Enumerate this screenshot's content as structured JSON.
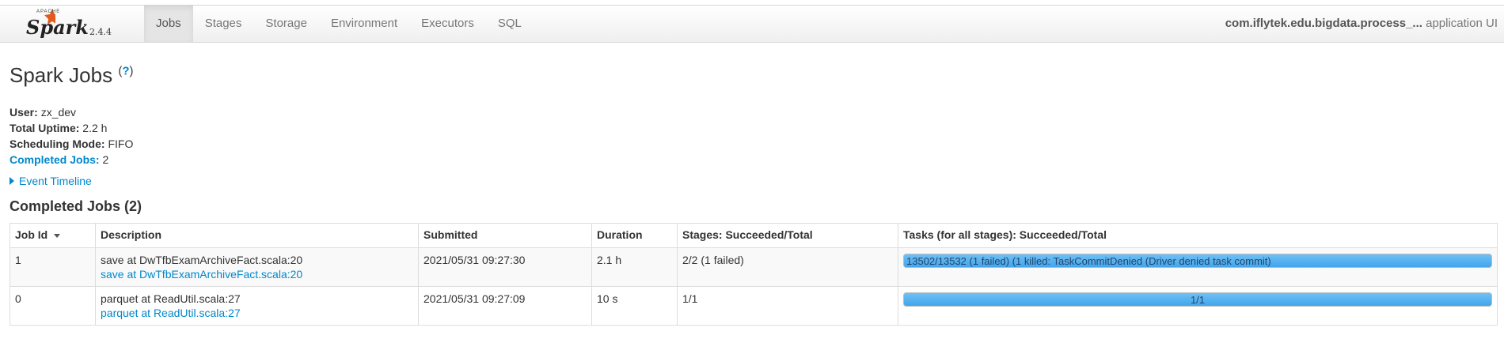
{
  "brand": {
    "apache": "APACHE",
    "spark": "Spark",
    "version": "2.4.4"
  },
  "nav": {
    "tabs": [
      {
        "label": "Jobs",
        "active": true
      },
      {
        "label": "Stages"
      },
      {
        "label": "Storage"
      },
      {
        "label": "Environment"
      },
      {
        "label": "Executors"
      },
      {
        "label": "SQL"
      }
    ],
    "app_name": "com.iflytek.edu.bigdata.process_...",
    "app_suffix": "application UI"
  },
  "page": {
    "title": "Spark Jobs",
    "help": "?",
    "summary": {
      "user_label": "User:",
      "user": "zx_dev",
      "uptime_label": "Total Uptime:",
      "uptime": "2.2 h",
      "mode_label": "Scheduling Mode:",
      "mode": "FIFO",
      "completed_label": "Completed Jobs:",
      "completed": "2"
    },
    "timeline": "Event Timeline",
    "section_title": "Completed Jobs (2)"
  },
  "table": {
    "headers": [
      "Job Id",
      "Description",
      "Submitted",
      "Duration",
      "Stages: Succeeded/Total",
      "Tasks (for all stages): Succeeded/Total"
    ],
    "rows": [
      {
        "id": "1",
        "desc": "save at DwTfbExamArchiveFact.scala:20",
        "desc_link": "save at DwTfbExamArchiveFact.scala:20",
        "submitted": "2021/05/31 09:27:30",
        "duration": "2.1 h",
        "stages": "2/2 (1 failed)",
        "tasks_text": "13502/13532 (1 failed) (1 killed: TaskCommitDenied (Driver denied task commit)",
        "tasks_progress": 0.998
      },
      {
        "id": "0",
        "desc": "parquet at ReadUtil.scala:27",
        "desc_link": "parquet at ReadUtil.scala:27",
        "submitted": "2021/05/31 09:27:09",
        "duration": "10 s",
        "stages": "1/1",
        "tasks_text": "1/1",
        "tasks_progress": 1.0
      }
    ]
  },
  "colors": {
    "link": "#0088cc",
    "progress": "#42a5ec"
  }
}
